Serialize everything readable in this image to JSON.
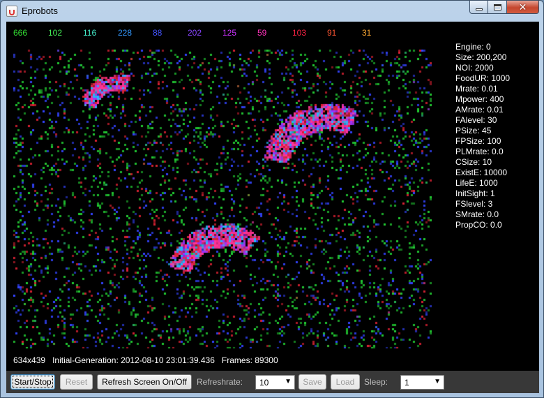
{
  "window": {
    "title": "Eprobots"
  },
  "counts": [
    {
      "value": "666",
      "color": "#33dd33"
    },
    {
      "value": "102",
      "color": "#44ee55"
    },
    {
      "value": "116",
      "color": "#44eecc"
    },
    {
      "value": "228",
      "color": "#3399ff"
    },
    {
      "value": "88",
      "color": "#4455ff"
    },
    {
      "value": "202",
      "color": "#8844ff"
    },
    {
      "value": "125",
      "color": "#cc33ff"
    },
    {
      "value": "59",
      "color": "#ff33bb"
    },
    {
      "value": "103",
      "color": "#ff2244"
    },
    {
      "value": "91",
      "color": "#ff5533"
    },
    {
      "value": "31",
      "color": "#ffaa33"
    }
  ],
  "params": [
    "Engine: 0",
    "Size: 200,200",
    "NOI: 2000",
    "FoodUR: 1000",
    "Mrate: 0.01",
    "Mpower: 400",
    "AMrate: 0.01",
    "FAlevel: 30",
    "PSize: 45",
    "FPSize: 100",
    "PLMrate: 0.0",
    "CSize: 10",
    "ExistE: 10000",
    "LifeE: 1000",
    "InitSight: 1",
    "FSlevel: 3",
    "SMrate: 0.0",
    "PropCO: 0.0"
  ],
  "status": {
    "size": "634x439",
    "initial_generation": "Initial-Generation: 2012-08-10 23:01:39.436",
    "frames": "Frames: 89300"
  },
  "toolbar": {
    "start_stop": "Start/Stop",
    "reset": "Reset",
    "refresh_toggle": "Refresh Screen On/Off",
    "refreshrate_label": "Refreshrate:",
    "refreshrate_value": "10",
    "save": "Save",
    "load": "Load",
    "sleep_label": "Sleep:",
    "sleep_value": "1"
  },
  "palette": {
    "food_green": "#22cc33",
    "food_blue": "#3344ff",
    "food_red": "#dd2233",
    "cluster_pink": "#ff3399",
    "cluster_purple": "#9933ff",
    "cluster_cyan": "#22bbff"
  }
}
